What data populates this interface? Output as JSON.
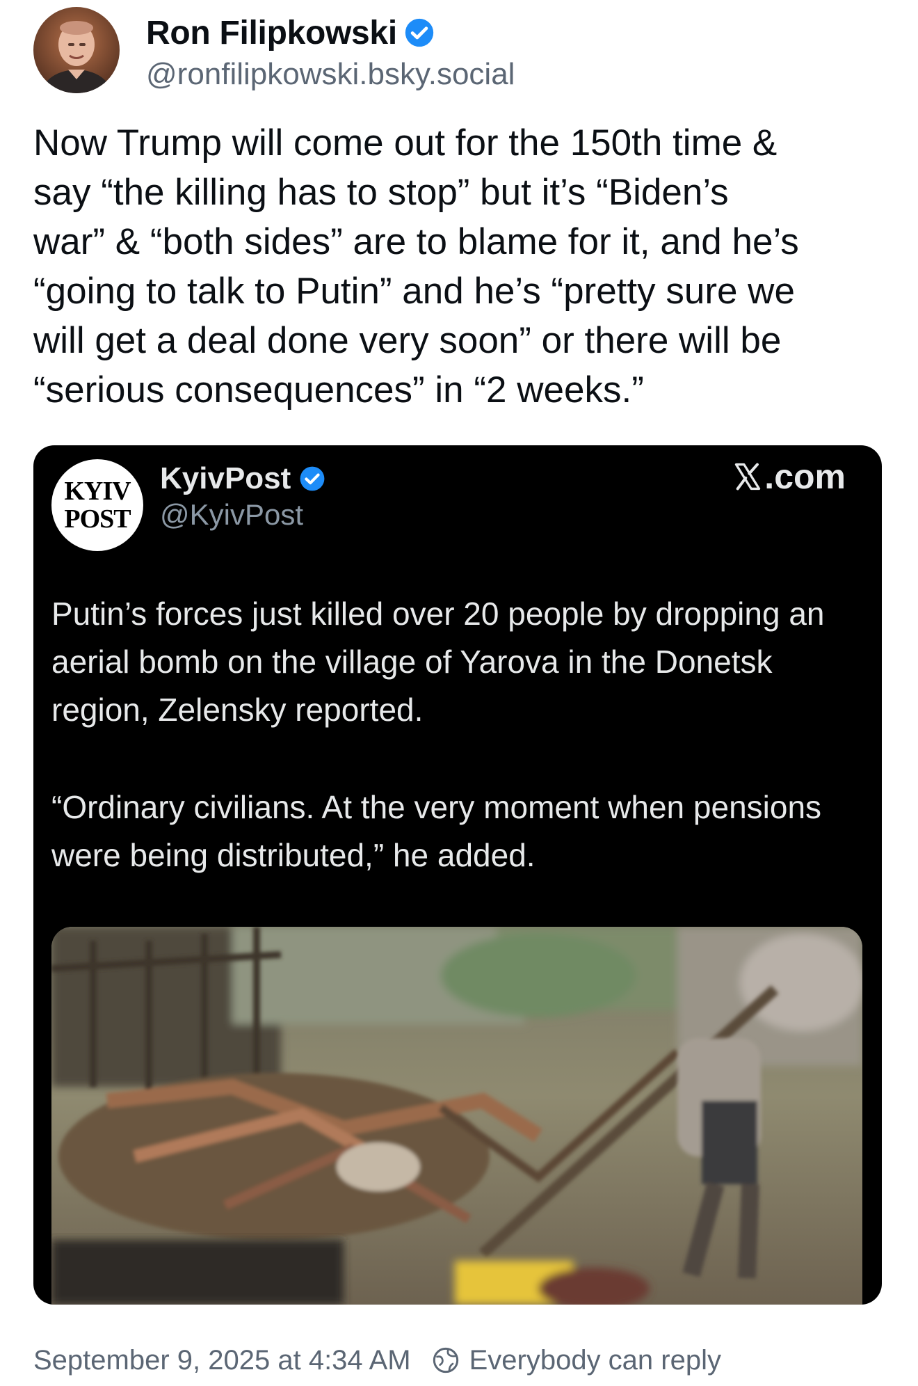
{
  "author": {
    "display_name": "Ron Filipkowski",
    "handle": "@ronfilipkowski.bsky.social",
    "verified": true
  },
  "post": {
    "text": "Now Trump will come out for the 150th  time &\nsay “the killing has to stop” but it’s “Biden’s\nwar” & “both sides” are to blame for it, and he’s\n“going to talk to Putin” and he’s “pretty sure we\nwill get a deal done very soon” or there will be\n“serious consequences” in “2 weeks.”"
  },
  "embed": {
    "logo_line1": "KYIV",
    "logo_line2": "POST",
    "name": "KyivPost",
    "handle": "@KyivPost",
    "verified": true,
    "source_label": ".com",
    "paragraph1": "Putin’s forces just killed over 20 people by dropping an aerial bomb on the village of Yarova in the Donetsk region, Zelensky reported.",
    "paragraph2": "“Ordinary civilians. At the very moment when pensions were being distributed,” he added."
  },
  "footer": {
    "timestamp": "September 9, 2025 at 4:34 AM",
    "reply_setting": "Everybody can reply"
  },
  "colors": {
    "verified_blue": "#1d8cf8",
    "muted_text": "#5b6674",
    "card_background": "#000000"
  },
  "icons": {
    "verified": "verified-check-icon",
    "x_logo": "x-logo-icon",
    "reply_setting": "globe-icon"
  }
}
